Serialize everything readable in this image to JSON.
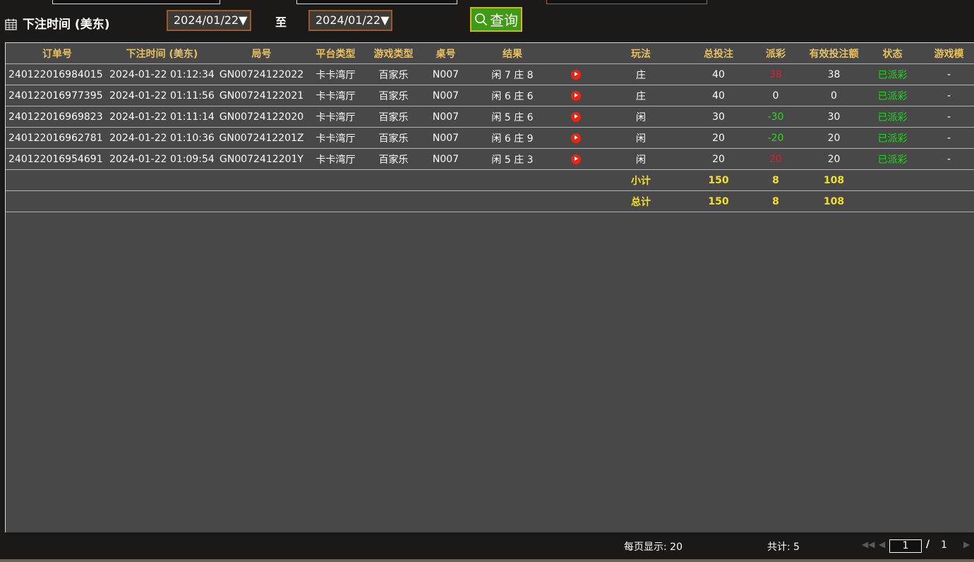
{
  "filter": {
    "label": "下注时间 (美东)",
    "date_from": "2024/01/22▼",
    "to_label": "至",
    "date_to": "2024/01/22▼",
    "query_label": "查询"
  },
  "table": {
    "headers": [
      "订单号",
      "下注时间 (美东)",
      "局号",
      "平台类型",
      "游戏类型",
      "桌号",
      "结果",
      "",
      "玩法",
      "总投注",
      "派彩",
      "有效投注额",
      "状态",
      "游戏模"
    ],
    "rows": [
      {
        "order": "240122016984015",
        "time": "2024-01-22 01:12:34",
        "round": "GN00724122022",
        "platform": "卡卡湾厅",
        "game": "百家乐",
        "table": "N007",
        "result": "闲 7 庄 8",
        "play": "庄",
        "bet": "40",
        "payout": "38",
        "valid": "38",
        "status": "已派彩",
        "mode": "-"
      },
      {
        "order": "240122016977395",
        "time": "2024-01-22 01:11:56",
        "round": "GN00724122021",
        "platform": "卡卡湾厅",
        "game": "百家乐",
        "table": "N007",
        "result": "闲 6 庄 6",
        "play": "庄",
        "bet": "40",
        "payout": "0",
        "valid": "0",
        "status": "已派彩",
        "mode": "-"
      },
      {
        "order": "240122016969823",
        "time": "2024-01-22 01:11:14",
        "round": "GN00724122020",
        "platform": "卡卡湾厅",
        "game": "百家乐",
        "table": "N007",
        "result": "闲 5 庄 6",
        "play": "闲",
        "bet": "30",
        "payout": "-30",
        "valid": "30",
        "status": "已派彩",
        "mode": "-"
      },
      {
        "order": "240122016962781",
        "time": "2024-01-22 01:10:36",
        "round": "GN0072412201Z",
        "platform": "卡卡湾厅",
        "game": "百家乐",
        "table": "N007",
        "result": "闲 6 庄 9",
        "play": "闲",
        "bet": "20",
        "payout": "-20",
        "valid": "20",
        "status": "已派彩",
        "mode": "-"
      },
      {
        "order": "240122016954691",
        "time": "2024-01-22 01:09:54",
        "round": "GN0072412201Y",
        "platform": "卡卡湾厅",
        "game": "百家乐",
        "table": "N007",
        "result": "闲 5 庄 3",
        "play": "闲",
        "bet": "20",
        "payout": "20",
        "valid": "20",
        "status": "已派彩",
        "mode": "-"
      }
    ],
    "subtotal": {
      "label": "小计",
      "bet": "150",
      "payout": "8",
      "valid": "108"
    },
    "total": {
      "label": "总计",
      "bet": "150",
      "payout": "8",
      "valid": "108"
    }
  },
  "footer": {
    "per_page": "每页显示: 20",
    "total_count": "共计: 5",
    "page_current": "1",
    "page_sep": "/",
    "page_total": "1"
  },
  "colors": {
    "header_text": "#e7c062",
    "sum_text": "#f3e022",
    "win": "#d32232",
    "loss": "#2bd818",
    "status": "#1fd41f",
    "query_bg": "#3f9a16"
  },
  "icons": {
    "calendar": "calendar-icon",
    "search": "search-icon",
    "play": "play-video-icon",
    "first_page": "first-page-icon",
    "prev_page": "prev-page-icon",
    "next_page": "next-page-icon"
  }
}
